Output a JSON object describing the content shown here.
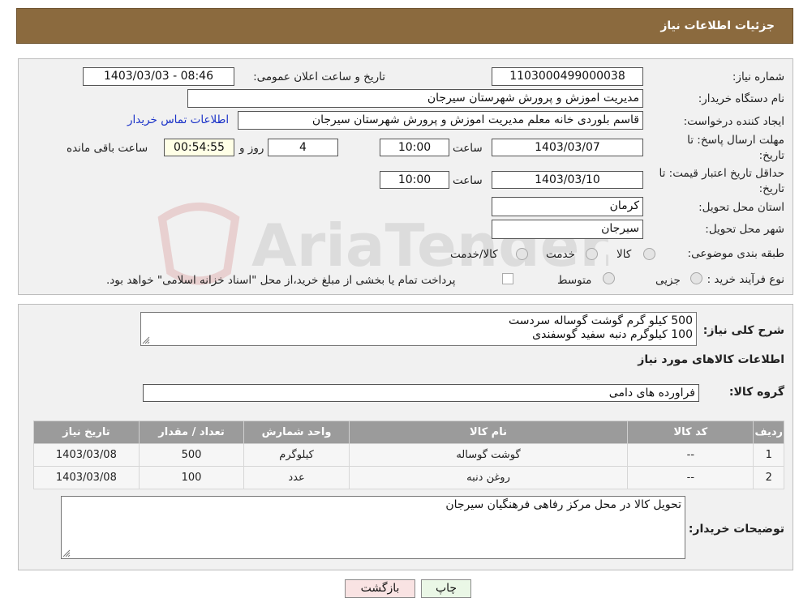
{
  "header": {
    "title": "جزئیات اطلاعات نیاز"
  },
  "info": {
    "need_number_label": "شماره نیاز:",
    "need_number": "1103000499000038",
    "announce_label": "تاریخ و ساعت اعلان عمومی:",
    "announce_value": "1403/03/03 - 08:46",
    "buyer_org_label": "نام دستگاه خریدار:",
    "buyer_org": "مدیریت اموزش و پرورش شهرستان سیرجان",
    "creator_label": "ایجاد کننده درخواست:",
    "creator": "قاسم بلوردی خانه معلم مدیریت اموزش و پرورش شهرستان سیرجان",
    "contact_link": "اطلاعات تماس خریدار",
    "deadline_label_1": "مهلت ارسال پاسخ: تا",
    "deadline_label_2": "تاریخ:",
    "deadline_date": "1403/03/07",
    "time_label": "ساعت",
    "deadline_time": "10:00",
    "days_value": "4",
    "days_label": "روز و",
    "remaining_time": "00:54:55",
    "remaining_label": "ساعت باقی مانده",
    "validity_label_1": "حداقل تاریخ اعتبار قیمت: تا",
    "validity_label_2": "تاریخ:",
    "validity_date": "1403/03/10",
    "validity_time_label": "ساعت",
    "validity_time": "10:00",
    "province_label": "استان محل تحویل:",
    "province": "کرمان",
    "city_label": "شهر محل تحویل:",
    "city": "سیرجان",
    "category_label": "طبقه بندی موضوعی:",
    "category_options": [
      "کالا",
      "خدمت",
      "کالا/خدمت"
    ],
    "process_label": "نوع فرآیند خرید :",
    "process_options": [
      "جزیی",
      "متوسط"
    ],
    "payment_note": "پرداخت تمام یا بخشی از مبلغ خرید،از محل \"اسناد خزانه اسلامی\" خواهد بود."
  },
  "watermark": {
    "text": "AriaTender.neT"
  },
  "description": {
    "label": "شرح کلی نیاز:",
    "lines": [
      "500 کیلو گرم گوشت گوساله سردست",
      "100 کیلوگرم دنبه سفید گوسفندی"
    ]
  },
  "goods": {
    "title": "اطلاعات کالاهای مورد نیاز",
    "group_label": "گروه کالا:",
    "group_value": "فراورده های دامی",
    "columns": [
      "ردیف",
      "کد کالا",
      "نام کالا",
      "واحد شمارش",
      "تعداد / مقدار",
      "تاریخ نیاز"
    ],
    "rows": [
      [
        "1",
        "--",
        "گوشت گوساله",
        "کیلوگرم",
        "500",
        "1403/03/08"
      ],
      [
        "2",
        "--",
        "روغن دنبه",
        "عدد",
        "100",
        "1403/03/08"
      ]
    ]
  },
  "buyer_notes": {
    "label": "توضیحات خریدار:",
    "text": "تحویل کالا در محل مرکز رفاهی فرهنگیان سیرجان"
  },
  "buttons": {
    "print": "چاپ",
    "back": "بازگشت"
  }
}
